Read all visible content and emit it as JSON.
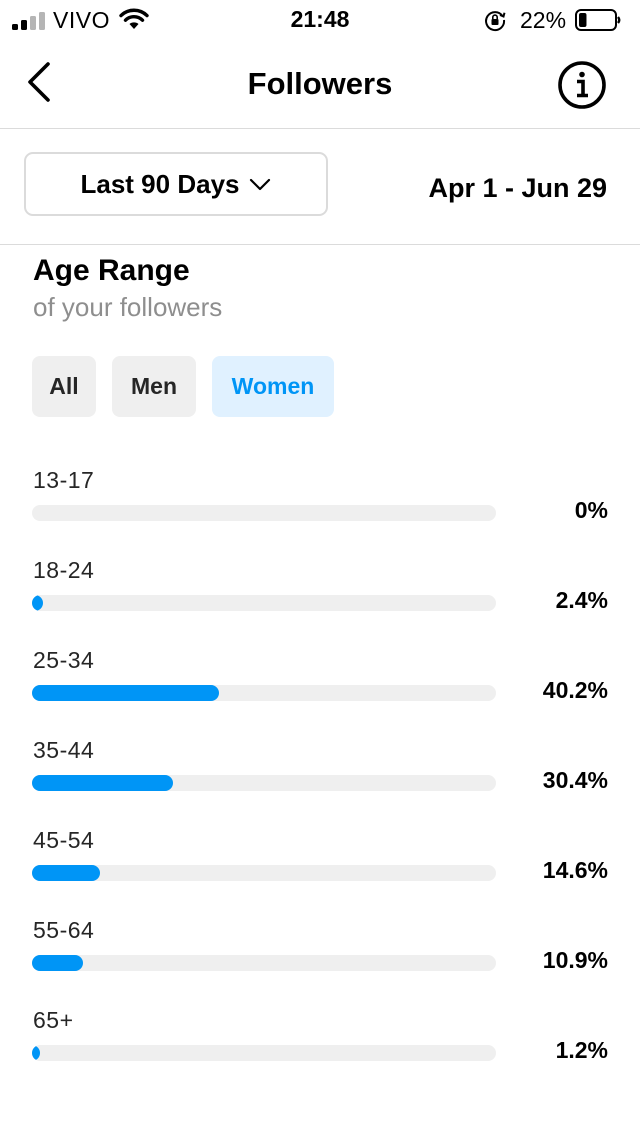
{
  "status_bar": {
    "carrier": "VIVO",
    "time": "21:48",
    "battery_percent": "22%",
    "battery_level": 0.22,
    "signal_bars_filled": 2,
    "signal_bars_total": 4
  },
  "header": {
    "title": "Followers",
    "back_icon": "chevron-left-icon",
    "info_icon": "info-circle-icon"
  },
  "filters": {
    "range_label": "Last 90 Days",
    "date_range": "Apr 1 - Jun 29"
  },
  "age_section": {
    "title": "Age Range",
    "subtitle": "of your followers",
    "segments": [
      {
        "label": "All",
        "selected": false
      },
      {
        "label": "Men",
        "selected": false
      },
      {
        "label": "Women",
        "selected": true
      }
    ],
    "rows": [
      {
        "label": "13-17",
        "value": 0,
        "display": "0%"
      },
      {
        "label": "18-24",
        "value": 2.4,
        "display": "2.4%"
      },
      {
        "label": "25-34",
        "value": 40.2,
        "display": "40.2%"
      },
      {
        "label": "35-44",
        "value": 30.4,
        "display": "30.4%"
      },
      {
        "label": "45-54",
        "value": 14.6,
        "display": "14.6%"
      },
      {
        "label": "55-64",
        "value": 10.9,
        "display": "10.9%"
      },
      {
        "label": "65+",
        "value": 1.2,
        "display": "1.2%"
      }
    ]
  },
  "colors": {
    "accent": "#0095f6",
    "track": "#efefef",
    "selected_segment_bg": "#e0f1ff",
    "segment_bg": "#efefef",
    "subtitle": "#8e8e8e",
    "divider": "#dbdbdb"
  }
}
